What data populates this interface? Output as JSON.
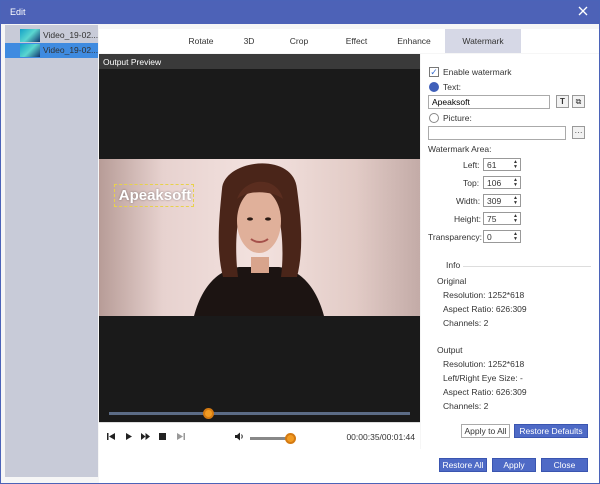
{
  "window": {
    "title": "Edit"
  },
  "files": [
    {
      "name": "Video_19-02..."
    },
    {
      "name": "Video_19-02..."
    }
  ],
  "tabs": [
    "Rotate",
    "3D",
    "Crop",
    "Effect",
    "Enhance",
    "Watermark"
  ],
  "preview": {
    "header": "Output Preview",
    "watermark_text": "Apeaksoft",
    "time": "00:00:35/00:01:44",
    "seek_progress": 0.33,
    "volume_level": 0.95
  },
  "watermark": {
    "enable_label": "Enable watermark",
    "enabled": true,
    "text_label": "Text:",
    "text_value": "Apeaksoft",
    "picture_label": "Picture:",
    "picture_value": "",
    "area_label": "Watermark Area:",
    "left_label": "Left:",
    "left_value": "61",
    "top_label": "Top:",
    "top_value": "106",
    "width_label": "Width:",
    "width_value": "309",
    "height_label": "Height:",
    "height_value": "75",
    "transparency_label": "Transparency:",
    "transparency_value": "0"
  },
  "info": {
    "heading": "Info",
    "original_heading": "Original",
    "original_resolution": "Resolution: 1252*618",
    "original_aspect": "Aspect Ratio: 626:309",
    "original_channels": "Channels: 2",
    "output_heading": "Output",
    "output_resolution": "Resolution: 1252*618",
    "output_eye": "Left/Right Eye Size: -",
    "output_aspect": "Aspect Ratio: 626:309",
    "output_channels": "Channels: 2"
  },
  "buttons": {
    "apply_to_all": "Apply to All",
    "restore_defaults": "Restore Defaults",
    "restore_all": "Restore All",
    "apply": "Apply",
    "close": "Close"
  },
  "colors": {
    "titlebar": "#4d62b7",
    "accent": "#4e6ac6",
    "slider": "#f29b22"
  }
}
